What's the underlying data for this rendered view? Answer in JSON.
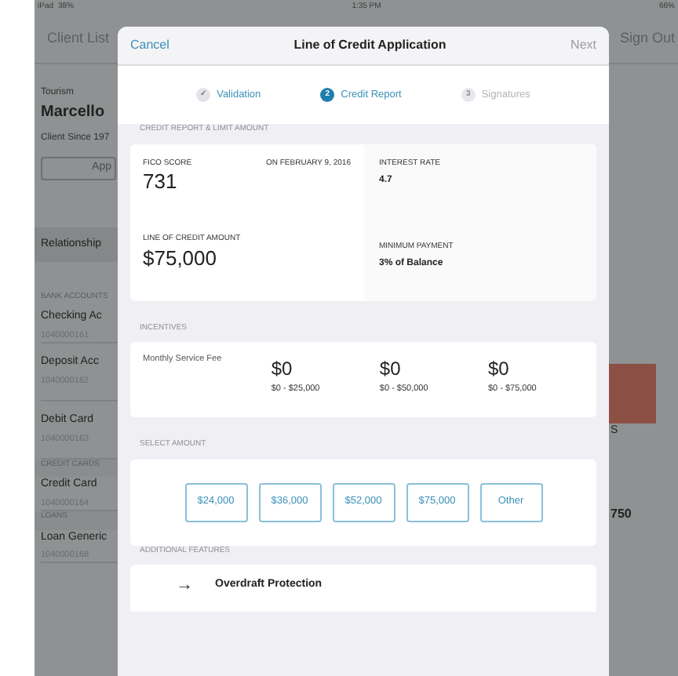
{
  "status_bar": {
    "device": "iPad",
    "signal": "38%",
    "time": "1:35 PM",
    "battery": "66%"
  },
  "background": {
    "nav": {
      "left": "Client List",
      "right": "Sign Out"
    },
    "client": {
      "category": "Tourism",
      "name": "Marcello",
      "since": "Client Since 197",
      "button": "App"
    },
    "menu": "Relationship",
    "sections": [
      {
        "title": "BANK ACCOUNTS",
        "items": [
          {
            "name": "Checking Ac",
            "number": "1040000161"
          },
          {
            "name": "Deposit Acc",
            "number": "1040000162"
          },
          {
            "name": "Debit Card",
            "number": "1040000163"
          }
        ]
      },
      {
        "title": "CREDIT CARDS",
        "items": [
          {
            "name": "Credit Card",
            "number": "1040000164"
          }
        ]
      },
      {
        "title": "LOANS",
        "items": [
          {
            "name": "Loan Generic",
            "number": "1040000168"
          }
        ]
      }
    ],
    "right_texts": [
      "S",
      "750"
    ]
  },
  "modal": {
    "cancel": "Cancel",
    "title": "Line of Credit Application",
    "next": "Next",
    "steps": [
      {
        "marker": "✓",
        "label": "Validation",
        "kind": "done"
      },
      {
        "marker": "2",
        "label": "Credit Report",
        "kind": "current"
      },
      {
        "marker": "3",
        "label": "Signatures",
        "kind": "upcoming"
      }
    ],
    "credit_report": {
      "title": "CREDIT REPORT & LIMIT AMOUNT",
      "fico_label": "FICO SCORE",
      "fico_date": "ON FEBRUARY 9, 2016",
      "fico": "731",
      "rate_label": "INTEREST RATE",
      "rate": "4.7",
      "amount_label": "LINE OF CREDIT AMOUNT",
      "amount": "$75,000",
      "payment_label": "MINIMUM PAYMENT",
      "payment": "3% of Balance"
    },
    "incentives": {
      "title": "INCENTIVES",
      "label": "Monthly Service Fee",
      "tiers": [
        {
          "fee": "$0",
          "range": "$0 - $25,000"
        },
        {
          "fee": "$0",
          "range": "$0 - $50,000"
        },
        {
          "fee": "$0",
          "range": "$0 - $75,000"
        }
      ]
    },
    "select_amount": {
      "title": "SELECT AMOUNT",
      "options": [
        {
          "label": "$24,000",
          "selected": false
        },
        {
          "label": "$36,000",
          "selected": false
        },
        {
          "label": "$52,000",
          "selected": false
        },
        {
          "label": "$75,000",
          "selected": false
        },
        {
          "label": "Other",
          "selected": false
        }
      ]
    },
    "additional": {
      "title": "ADDITIONAL FEATURES",
      "items": [
        {
          "icon": "→",
          "label": "Overdraft Protection"
        }
      ]
    }
  }
}
